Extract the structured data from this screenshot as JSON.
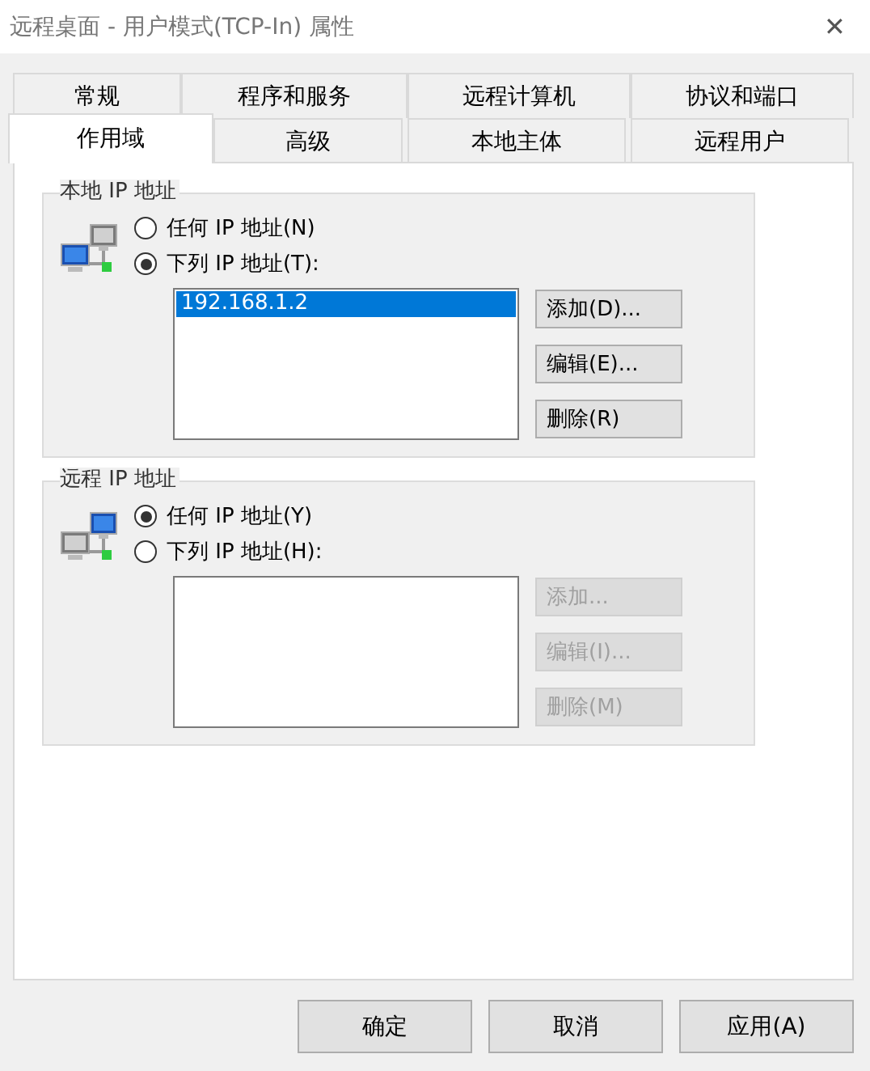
{
  "window": {
    "title": "远程桌面 - 用户模式(TCP-In) 属性",
    "close": "✕"
  },
  "tab_rows": [
    [
      {
        "label": "常规",
        "selected": false
      },
      {
        "label": "程序和服务",
        "selected": false
      },
      {
        "label": "远程计算机",
        "selected": false
      },
      {
        "label": "协议和端口",
        "selected": false
      }
    ],
    [
      {
        "label": "作用域",
        "selected": true
      },
      {
        "label": "高级",
        "selected": false
      },
      {
        "label": "本地主体",
        "selected": false
      },
      {
        "label": "远程用户",
        "selected": false
      }
    ]
  ],
  "groups": [
    {
      "title": "本地 IP 地址",
      "kind": "local",
      "radios": [
        {
          "label": "任何 IP 地址(N)",
          "selected": false
        },
        {
          "label": "下列 IP 地址(T):",
          "selected": true
        }
      ],
      "list": [
        {
          "text": "192.168.1.2",
          "selected": true
        }
      ],
      "buttons": [
        {
          "label": "添加(D)...",
          "disabled": false
        },
        {
          "label": "编辑(E)...",
          "disabled": false
        },
        {
          "label": "删除(R)",
          "disabled": false
        }
      ]
    },
    {
      "title": "远程 IP 地址",
      "kind": "remote",
      "radios": [
        {
          "label": "任何 IP 地址(Y)",
          "selected": true
        },
        {
          "label": "下列 IP 地址(H):",
          "selected": false
        }
      ],
      "buttons": [
        {
          "label": "添加...",
          "disabled": true
        },
        {
          "label": "编辑(I)...",
          "disabled": true
        },
        {
          "label": "删除(M)",
          "disabled": true
        }
      ]
    }
  ],
  "footer_buttons": [
    "确定",
    "取消",
    "应用(A)"
  ]
}
